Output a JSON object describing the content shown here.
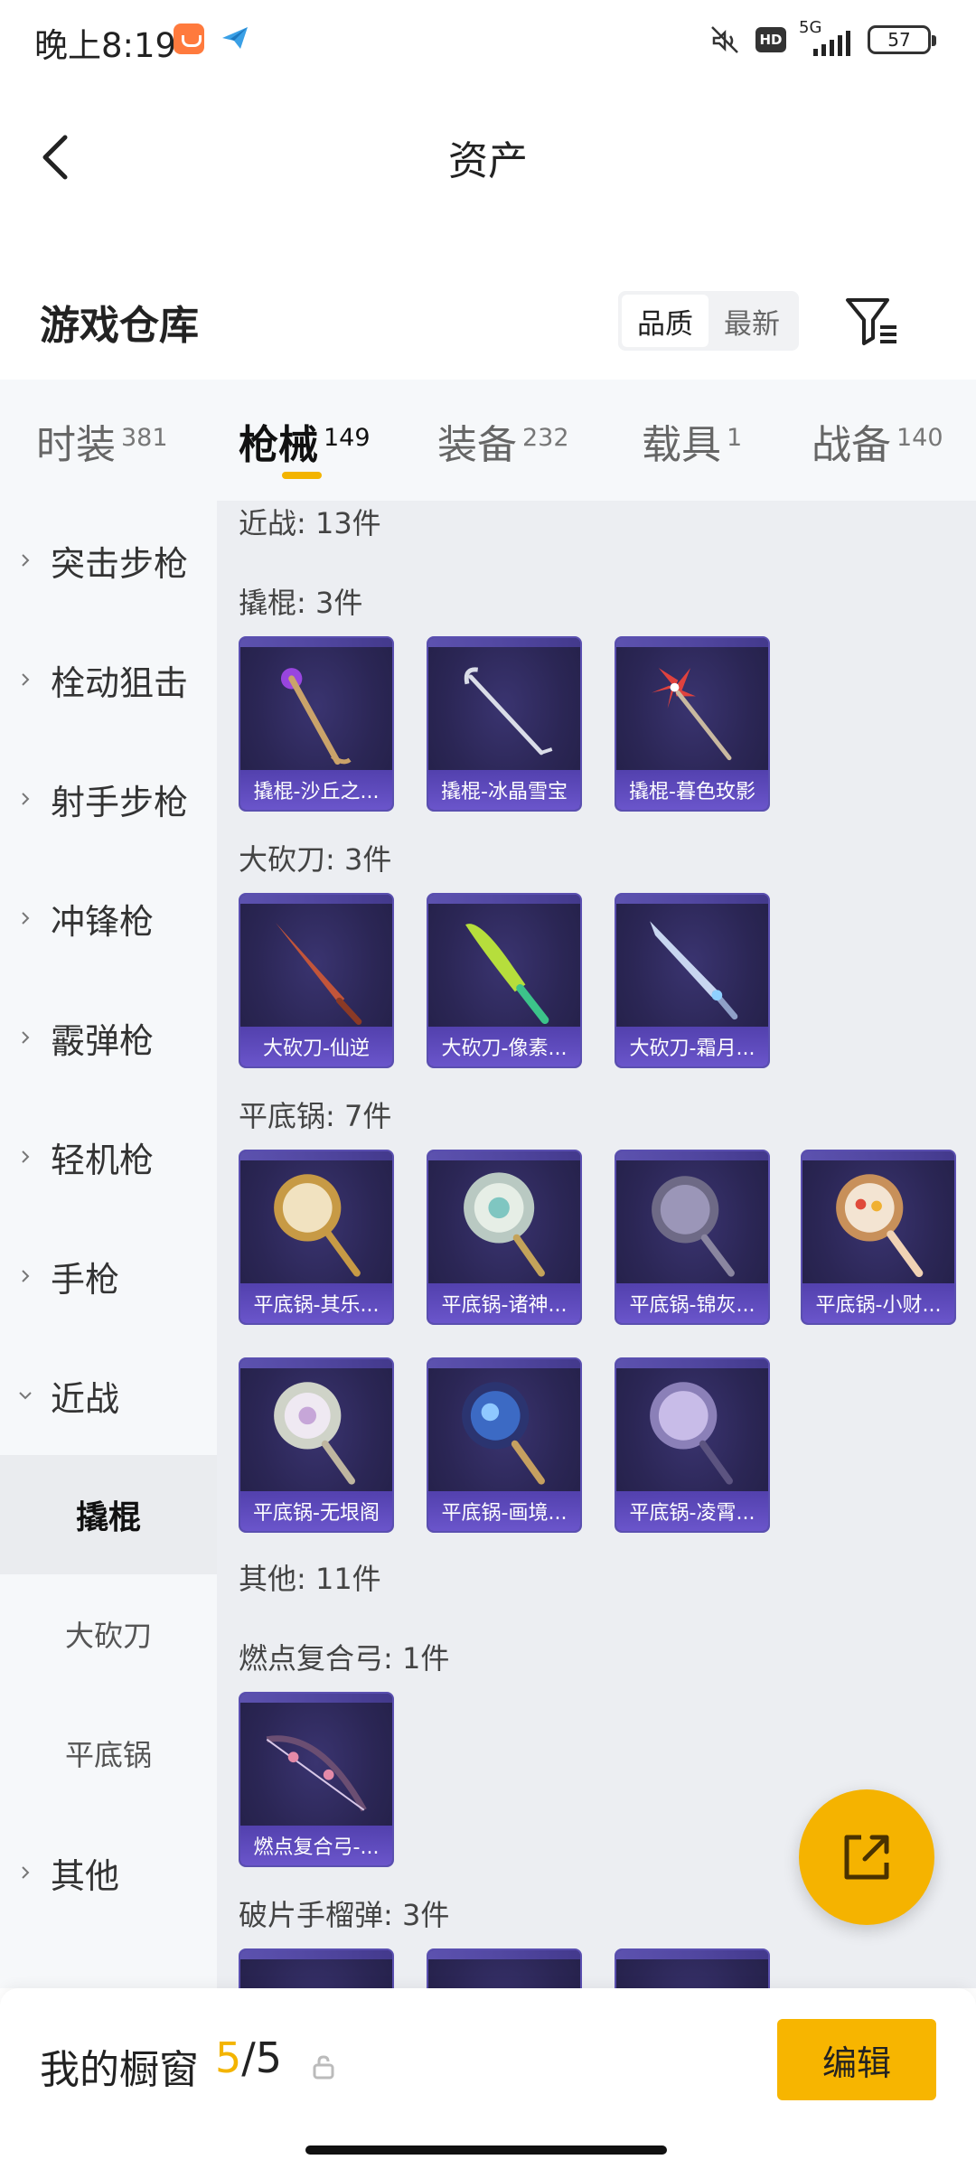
{
  "status_bar": {
    "time": "晚上8:19",
    "network": "5G",
    "hd": "HD",
    "battery": "57",
    "icons": [
      "app-notification-icon",
      "paper-plane-icon",
      "mute-icon",
      "signal-icon",
      "battery-icon"
    ]
  },
  "header": {
    "title": "资产",
    "back_icon": "chevron-left-icon"
  },
  "warehouse": {
    "title": "游戏仓库",
    "sort_options": [
      "品质",
      "最新"
    ],
    "sort_selected": "品质",
    "filter_icon": "filter-icon"
  },
  "tabs": [
    {
      "name": "时装",
      "count": "381",
      "active": false
    },
    {
      "name": "枪械",
      "count": "149",
      "active": true
    },
    {
      "name": "装备",
      "count": "232",
      "active": false
    },
    {
      "name": "载具",
      "count": "1",
      "active": false
    },
    {
      "name": "战备",
      "count": "140",
      "active": false
    }
  ],
  "sidebar": {
    "categories": [
      "突击步枪",
      "栓动狙击",
      "射手步枪",
      "冲锋枪",
      "霰弹枪",
      "轻机枪",
      "手枪",
      "近战",
      "其他"
    ],
    "expanded": "近战",
    "subcategories": [
      "撬棍",
      "大砍刀",
      "平底锅"
    ],
    "selected_sub": "撬棍"
  },
  "content": {
    "sections": [
      {
        "label": "近战: 13件"
      },
      {
        "label": "撬棍: 3件",
        "items": [
          "撬棍-沙丘之...",
          "撬棍-冰晶雪宝",
          "撬棍-暮色玫影"
        ]
      },
      {
        "label": "大砍刀: 3件",
        "items": [
          "大砍刀-仙逆",
          "大砍刀-像素...",
          "大砍刀-霜月..."
        ]
      },
      {
        "label": "平底锅: 7件",
        "items": [
          "平底锅-其乐...",
          "平底锅-诸神...",
          "平底锅-锦灰...",
          "平底锅-小财...",
          "平底锅-无垠阁",
          "平底锅-画境...",
          "平底锅-凌霄..."
        ]
      },
      {
        "label": "其他: 11件"
      },
      {
        "label": "燃点复合弓: 1件",
        "items": [
          "燃点复合弓-..."
        ]
      },
      {
        "label": "破片手榴弹: 3件",
        "items": [
          "",
          "",
          ""
        ]
      }
    ]
  },
  "fab": {
    "icon": "share-icon"
  },
  "bottom_bar": {
    "label": "我的橱窗",
    "current": "5",
    "separator": "/",
    "max": "5",
    "lock_icon": "lock-icon",
    "edit_label": "编辑"
  },
  "colors": {
    "accent": "#f5b300",
    "card_bg": "#2b2655",
    "card_border": "#5a4fb0",
    "sidebar_bg": "#f6f8fa",
    "content_bg": "#eceef2"
  }
}
